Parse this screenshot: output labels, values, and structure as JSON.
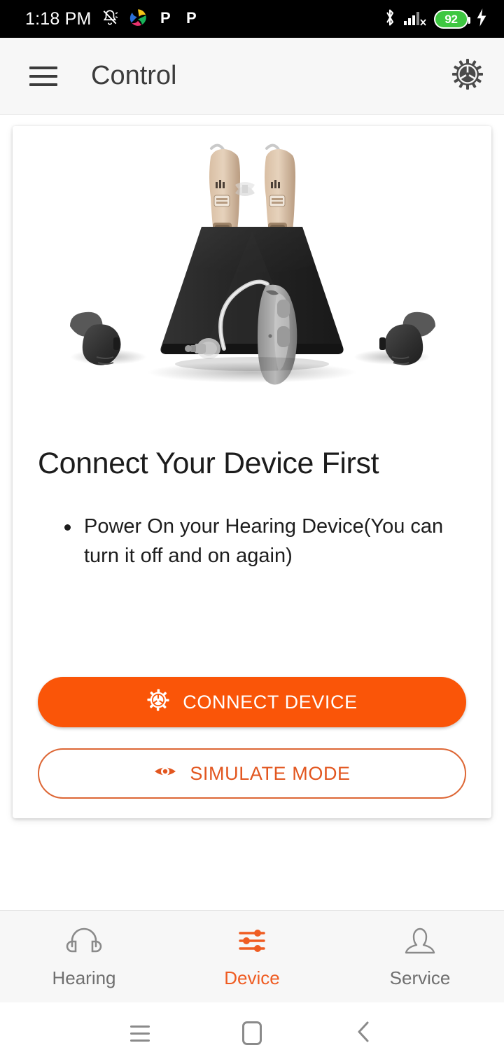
{
  "status_bar": {
    "time": "1:18 PM",
    "battery_percent": "92",
    "left_icons": [
      "notifications-off-icon",
      "pinwheel-icon",
      "p-app-icon",
      "p-app-icon-2"
    ],
    "right_icons": [
      "bluetooth-icon",
      "signal-no-sim-icon",
      "battery-icon",
      "charging-bolt-icon"
    ],
    "background": "#000000"
  },
  "app_bar": {
    "title": "Control",
    "menu_icon": "hamburger-menu-icon",
    "settings_icon": "gear-icon",
    "background": "#f7f7f7"
  },
  "card": {
    "image_alt": "hearing-devices-product-photo",
    "headline": "Connect Your Device First",
    "bullets": [
      "Power On your Hearing Device(You can turn it off and on again)"
    ],
    "primary_button": {
      "label": "CONNECT DEVICE",
      "icon": "gear-icon",
      "background": "#fa5508",
      "text_color": "#ffffff"
    },
    "secondary_button": {
      "label": "SIMULATE MODE",
      "icon": "eye-icon",
      "border_color": "#dd6634",
      "text_color": "#e2561f"
    }
  },
  "bottom_nav": {
    "accent_color": "#ef5c22",
    "inactive_color": "#6f6f6f",
    "items": [
      {
        "label": "Hearing",
        "icon": "headphones-icon",
        "active": false
      },
      {
        "label": "Device",
        "icon": "sliders-icon",
        "active": true
      },
      {
        "label": "Service",
        "icon": "person-icon",
        "active": false
      }
    ]
  },
  "system_nav": {
    "recents_icon": "recents-icon",
    "home_icon": "home-icon",
    "back_icon": "back-chevron-icon"
  }
}
